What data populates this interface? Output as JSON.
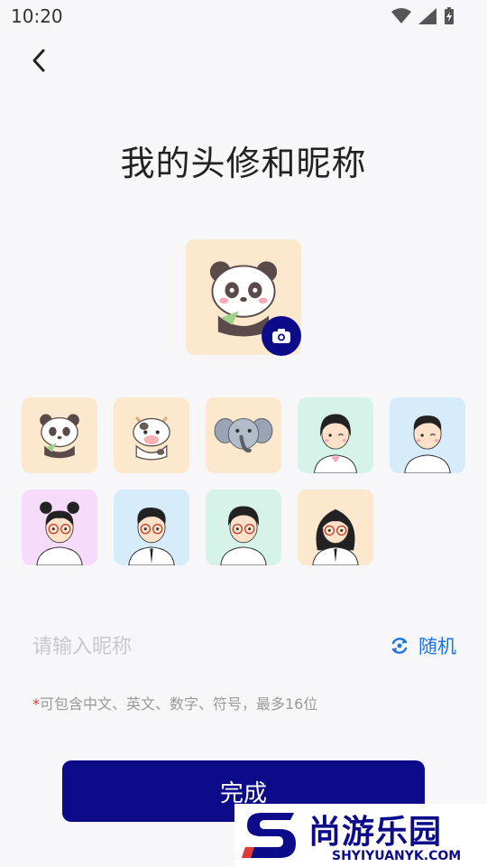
{
  "status_bar": {
    "time": "10:20"
  },
  "page": {
    "title": "我的头修和昵称"
  },
  "avatar": {
    "selected": "panda",
    "options": [
      {
        "id": "panda",
        "bg": "#fbe8cd"
      },
      {
        "id": "cow",
        "bg": "#fbe8cd"
      },
      {
        "id": "elephant",
        "bg": "#fbe8cd"
      },
      {
        "id": "girl-bangs",
        "bg": "#d6f3ea"
      },
      {
        "id": "boy-wink",
        "bg": "#d6ecfb"
      },
      {
        "id": "girl-buns-glasses",
        "bg": "#f6dbfb"
      },
      {
        "id": "boy-glasses-blue",
        "bg": "#d6ecfb"
      },
      {
        "id": "boy-glasses-green",
        "bg": "#d6f3ea"
      },
      {
        "id": "girl-long-hair-glasses",
        "bg": "#fbe8cd"
      }
    ]
  },
  "nickname": {
    "placeholder": "请输入昵称",
    "value": "",
    "random_label": "随机"
  },
  "hint": {
    "star": "*",
    "text": "可包含中文、英文、数字、符号，最多16位"
  },
  "actions": {
    "done_label": "完成"
  },
  "watermark": {
    "text": "尚游乐园",
    "url": "SHYIYUANYK.COM"
  },
  "colors": {
    "primary": "#0c0c8a",
    "accent_link": "#1a73e8",
    "background": "#f7f7fa"
  }
}
